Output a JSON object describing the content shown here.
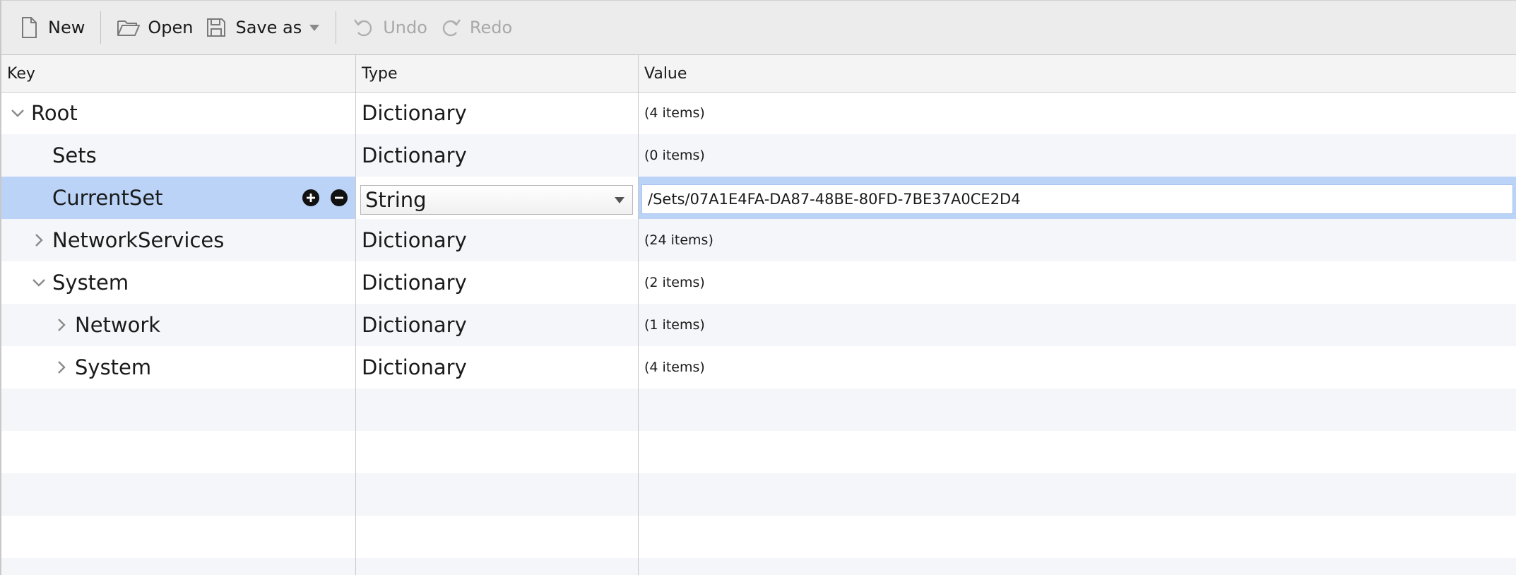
{
  "toolbar": {
    "new_label": "New",
    "open_label": "Open",
    "save_as_label": "Save as",
    "undo_label": "Undo",
    "redo_label": "Redo"
  },
  "columns": {
    "key": "Key",
    "type": "Type",
    "value": "Value"
  },
  "rows": [
    {
      "key": "Root",
      "type": "Dictionary",
      "value": "(4 items)",
      "level": 0,
      "expander": "expanded"
    },
    {
      "key": "Sets",
      "type": "Dictionary",
      "value": "(0 items)",
      "level": 1,
      "expander": "none"
    },
    {
      "key": "CurrentSet",
      "type": "String",
      "value": "/Sets/07A1E4FA-DA87-48BE-80FD-7BE37A0CE2D4",
      "level": 1,
      "expander": "none",
      "selected": true
    },
    {
      "key": "NetworkServices",
      "type": "Dictionary",
      "value": "(24 items)",
      "level": 1,
      "expander": "collapsed"
    },
    {
      "key": "System",
      "type": "Dictionary",
      "value": "(2 items)",
      "level": 1,
      "expander": "expanded"
    },
    {
      "key": "Network",
      "type": "Dictionary",
      "value": "(1 items)",
      "level": 2,
      "expander": "collapsed"
    },
    {
      "key": "System",
      "type": "Dictionary",
      "value": "(4 items)",
      "level": 2,
      "expander": "collapsed"
    }
  ],
  "colors": {
    "selected_row": "#bad3f7",
    "alt_row": "#f5f6fa",
    "toolbar_bg": "#ececec"
  }
}
